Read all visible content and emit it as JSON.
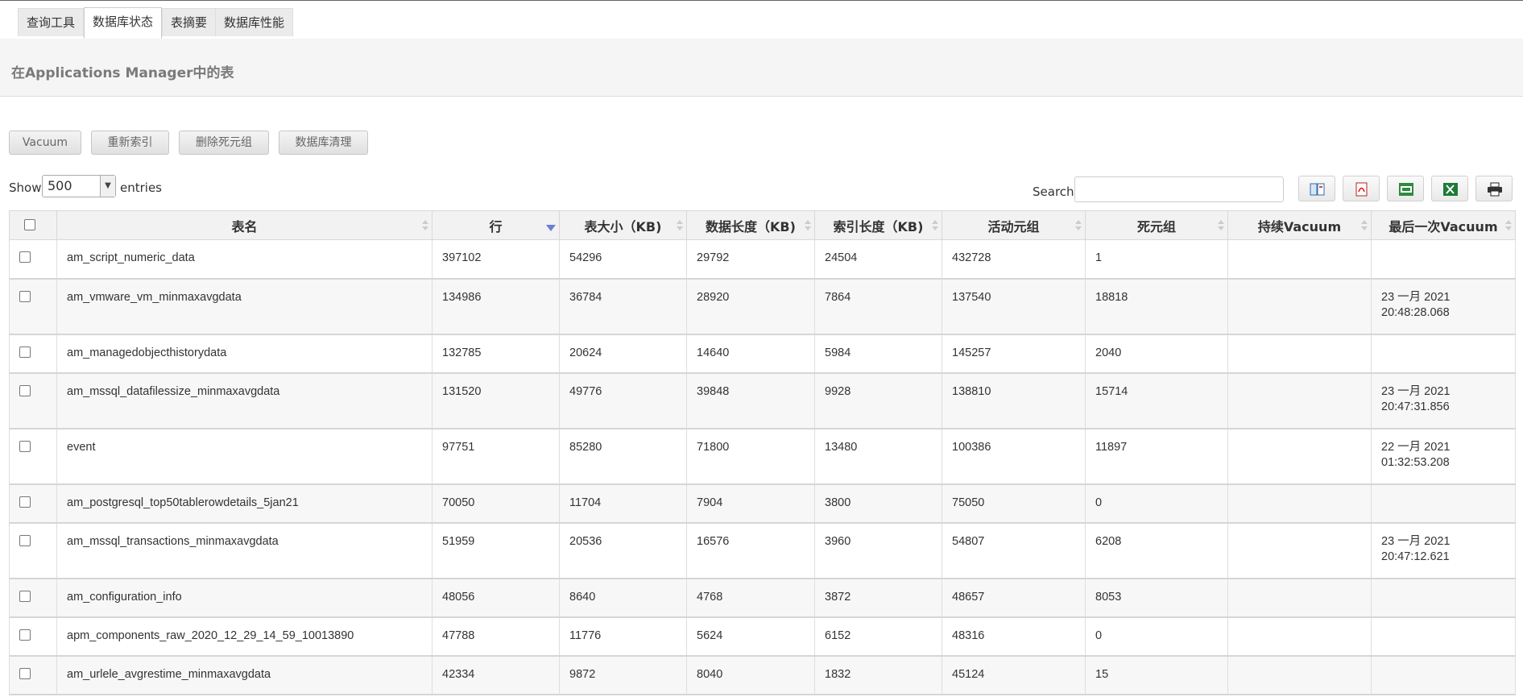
{
  "tabs": [
    "查询工具",
    "数据库状态",
    "表摘要",
    "数据库性能"
  ],
  "active_tab": "数据库状态",
  "page_title": "在Applications Manager中的表",
  "actions": [
    "Vacuum",
    "重新索引",
    "删除死元组",
    "数据库清理"
  ],
  "length": {
    "show_label": "Show",
    "value": "500",
    "entries_label": "entries"
  },
  "search": {
    "label": "Search:",
    "value": ""
  },
  "toolbar_icons": [
    "column-visibility-icon",
    "pdf-icon",
    "csv-icon",
    "excel-icon",
    "print-icon"
  ],
  "table": {
    "columns": [
      "表名",
      "行",
      "表大小（KB)",
      "数据长度（KB)",
      "索引长度（KB)",
      "活动元组",
      "死元组",
      "持续Vacuum",
      "最后一次Vacuum"
    ],
    "sorted_column": "行",
    "sort_direction": "desc",
    "rows": [
      {
        "name": "am_script_numeric_data",
        "rows": "397102",
        "size": "54296",
        "data": "29792",
        "index": "24504",
        "live": "432728",
        "dead": "1",
        "cont": "",
        "last_date": "",
        "last_time": ""
      },
      {
        "name": "am_vmware_vm_minmaxavgdata",
        "rows": "134986",
        "size": "36784",
        "data": "28920",
        "index": "7864",
        "live": "137540",
        "dead": "18818",
        "cont": "",
        "last_date": "23 一月 2021",
        "last_time": "20:48:28.068"
      },
      {
        "name": "am_managedobjecthistorydata",
        "rows": "132785",
        "size": "20624",
        "data": "14640",
        "index": "5984",
        "live": "145257",
        "dead": "2040",
        "cont": "",
        "last_date": "",
        "last_time": ""
      },
      {
        "name": "am_mssql_datafilessize_minmaxavgdata",
        "rows": "131520",
        "size": "49776",
        "data": "39848",
        "index": "9928",
        "live": "138810",
        "dead": "15714",
        "cont": "",
        "last_date": "23 一月 2021",
        "last_time": "20:47:31.856"
      },
      {
        "name": "event",
        "rows": "97751",
        "size": "85280",
        "data": "71800",
        "index": "13480",
        "live": "100386",
        "dead": "11897",
        "cont": "",
        "last_date": "22 一月 2021",
        "last_time": "01:32:53.208"
      },
      {
        "name": "am_postgresql_top50tablerowdetails_5jan21",
        "rows": "70050",
        "size": "11704",
        "data": "7904",
        "index": "3800",
        "live": "75050",
        "dead": "0",
        "cont": "",
        "last_date": "",
        "last_time": ""
      },
      {
        "name": "am_mssql_transactions_minmaxavgdata",
        "rows": "51959",
        "size": "20536",
        "data": "16576",
        "index": "3960",
        "live": "54807",
        "dead": "6208",
        "cont": "",
        "last_date": "23 一月 2021",
        "last_time": "20:47:12.621"
      },
      {
        "name": "am_configuration_info",
        "rows": "48056",
        "size": "8640",
        "data": "4768",
        "index": "3872",
        "live": "48657",
        "dead": "8053",
        "cont": "",
        "last_date": "",
        "last_time": ""
      },
      {
        "name": "apm_components_raw_2020_12_29_14_59_10013890",
        "rows": "47788",
        "size": "11776",
        "data": "5624",
        "index": "6152",
        "live": "48316",
        "dead": "0",
        "cont": "",
        "last_date": "",
        "last_time": ""
      },
      {
        "name": "am_urlele_avgrestime_minmaxavgdata",
        "rows": "42334",
        "size": "9872",
        "data": "8040",
        "index": "1832",
        "live": "45124",
        "dead": "15",
        "cont": "",
        "last_date": "",
        "last_time": ""
      }
    ]
  }
}
